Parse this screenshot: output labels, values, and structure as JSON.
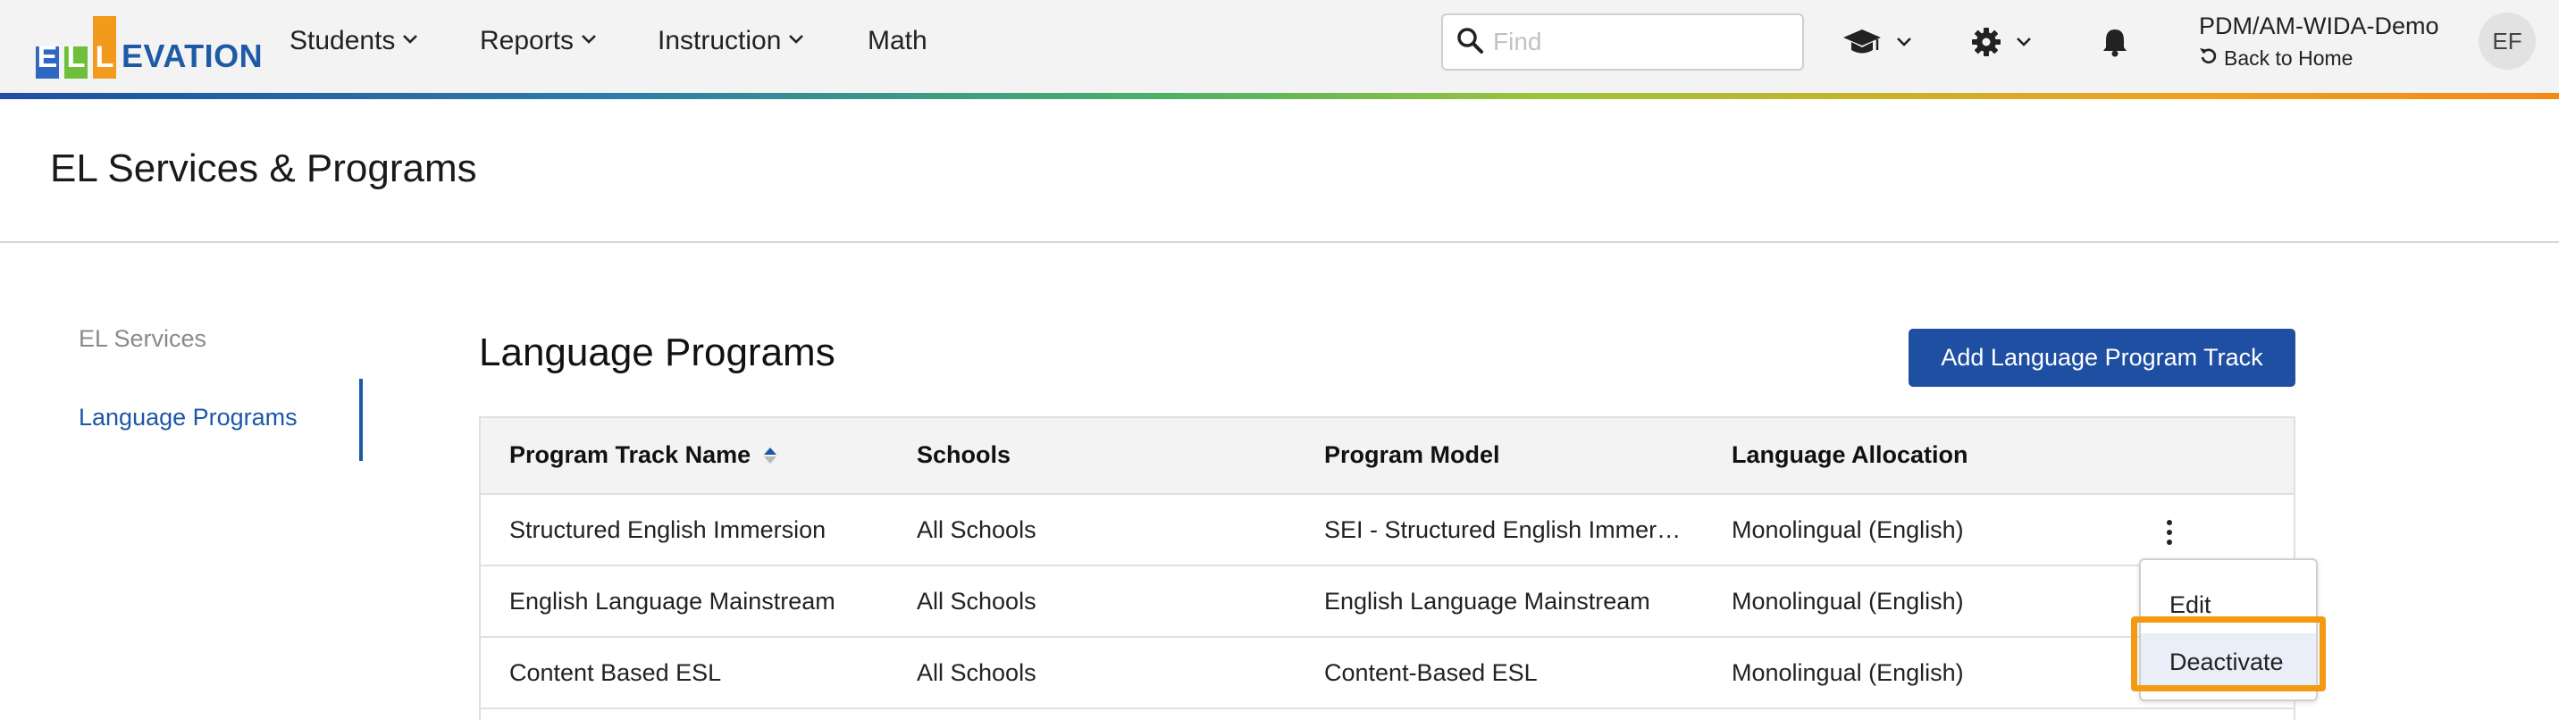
{
  "app": {
    "logo_letters": [
      "E",
      "L",
      "L"
    ],
    "logo_word": "EVATION",
    "colors": {
      "brand_blue": "#1f4fa3",
      "logo_green": "#6fbf3c",
      "logo_orange": "#f39a1c",
      "highlight_orange": "#f39a12"
    }
  },
  "nav": {
    "items": [
      {
        "label": "Students",
        "has_dropdown": true
      },
      {
        "label": "Reports",
        "has_dropdown": true
      },
      {
        "label": "Instruction",
        "has_dropdown": true
      },
      {
        "label": "Math",
        "has_dropdown": false
      }
    ],
    "search": {
      "placeholder": "Find",
      "value": ""
    },
    "icons": [
      "graduation-cap-icon",
      "gear-icon",
      "bell-icon"
    ],
    "user": {
      "account": "PDM/AM-WIDA-Demo",
      "back_label": "Back to Home",
      "initials": "EF"
    }
  },
  "page": {
    "title": "EL Services & Programs"
  },
  "sidebar": {
    "items": [
      {
        "label": "EL Services",
        "active": false
      },
      {
        "label": "Language Programs",
        "active": true
      }
    ]
  },
  "main": {
    "title": "Language Programs",
    "add_button": "Add Language Program Track",
    "table": {
      "columns": [
        "Program Track Name",
        "Schools",
        "Program Model",
        "Language Allocation"
      ],
      "sorted_column": "Program Track Name",
      "rows": [
        [
          "Structured English Immersion",
          "All Schools",
          "SEI - Structured English Immer…",
          "Monolingual (English)"
        ],
        [
          "English Language Mainstream",
          "All Schools",
          "English Language Mainstream",
          "Monolingual (English)"
        ],
        [
          "Content Based ESL",
          "All Schools",
          "Content-Based ESL",
          "Monolingual (English)"
        ]
      ]
    },
    "row_menu": {
      "items": [
        "Edit",
        "Deactivate"
      ],
      "highlighted": "Deactivate"
    }
  }
}
